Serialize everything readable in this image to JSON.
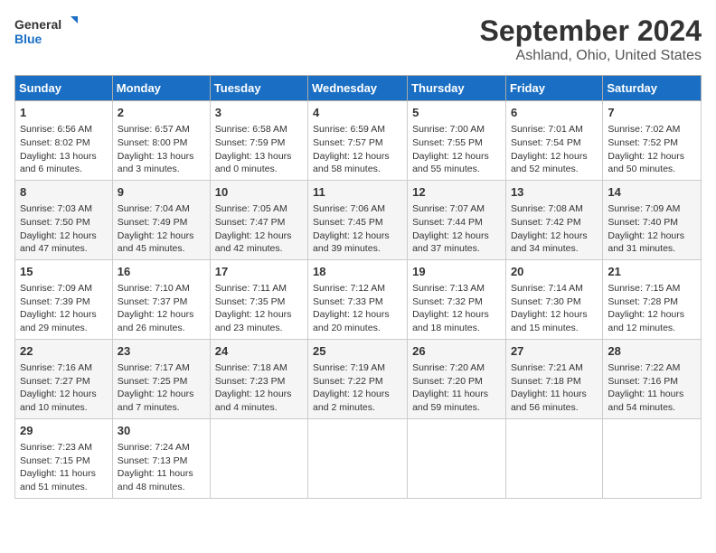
{
  "header": {
    "logo_line1": "General",
    "logo_line2": "Blue",
    "month_title": "September 2024",
    "location": "Ashland, Ohio, United States"
  },
  "days_of_week": [
    "Sunday",
    "Monday",
    "Tuesday",
    "Wednesday",
    "Thursday",
    "Friday",
    "Saturday"
  ],
  "weeks": [
    [
      {
        "day": "1",
        "info": "Sunrise: 6:56 AM\nSunset: 8:02 PM\nDaylight: 13 hours and 6 minutes."
      },
      {
        "day": "2",
        "info": "Sunrise: 6:57 AM\nSunset: 8:00 PM\nDaylight: 13 hours and 3 minutes."
      },
      {
        "day": "3",
        "info": "Sunrise: 6:58 AM\nSunset: 7:59 PM\nDaylight: 13 hours and 0 minutes."
      },
      {
        "day": "4",
        "info": "Sunrise: 6:59 AM\nSunset: 7:57 PM\nDaylight: 12 hours and 58 minutes."
      },
      {
        "day": "5",
        "info": "Sunrise: 7:00 AM\nSunset: 7:55 PM\nDaylight: 12 hours and 55 minutes."
      },
      {
        "day": "6",
        "info": "Sunrise: 7:01 AM\nSunset: 7:54 PM\nDaylight: 12 hours and 52 minutes."
      },
      {
        "day": "7",
        "info": "Sunrise: 7:02 AM\nSunset: 7:52 PM\nDaylight: 12 hours and 50 minutes."
      }
    ],
    [
      {
        "day": "8",
        "info": "Sunrise: 7:03 AM\nSunset: 7:50 PM\nDaylight: 12 hours and 47 minutes."
      },
      {
        "day": "9",
        "info": "Sunrise: 7:04 AM\nSunset: 7:49 PM\nDaylight: 12 hours and 45 minutes."
      },
      {
        "day": "10",
        "info": "Sunrise: 7:05 AM\nSunset: 7:47 PM\nDaylight: 12 hours and 42 minutes."
      },
      {
        "day": "11",
        "info": "Sunrise: 7:06 AM\nSunset: 7:45 PM\nDaylight: 12 hours and 39 minutes."
      },
      {
        "day": "12",
        "info": "Sunrise: 7:07 AM\nSunset: 7:44 PM\nDaylight: 12 hours and 37 minutes."
      },
      {
        "day": "13",
        "info": "Sunrise: 7:08 AM\nSunset: 7:42 PM\nDaylight: 12 hours and 34 minutes."
      },
      {
        "day": "14",
        "info": "Sunrise: 7:09 AM\nSunset: 7:40 PM\nDaylight: 12 hours and 31 minutes."
      }
    ],
    [
      {
        "day": "15",
        "info": "Sunrise: 7:09 AM\nSunset: 7:39 PM\nDaylight: 12 hours and 29 minutes."
      },
      {
        "day": "16",
        "info": "Sunrise: 7:10 AM\nSunset: 7:37 PM\nDaylight: 12 hours and 26 minutes."
      },
      {
        "day": "17",
        "info": "Sunrise: 7:11 AM\nSunset: 7:35 PM\nDaylight: 12 hours and 23 minutes."
      },
      {
        "day": "18",
        "info": "Sunrise: 7:12 AM\nSunset: 7:33 PM\nDaylight: 12 hours and 20 minutes."
      },
      {
        "day": "19",
        "info": "Sunrise: 7:13 AM\nSunset: 7:32 PM\nDaylight: 12 hours and 18 minutes."
      },
      {
        "day": "20",
        "info": "Sunrise: 7:14 AM\nSunset: 7:30 PM\nDaylight: 12 hours and 15 minutes."
      },
      {
        "day": "21",
        "info": "Sunrise: 7:15 AM\nSunset: 7:28 PM\nDaylight: 12 hours and 12 minutes."
      }
    ],
    [
      {
        "day": "22",
        "info": "Sunrise: 7:16 AM\nSunset: 7:27 PM\nDaylight: 12 hours and 10 minutes."
      },
      {
        "day": "23",
        "info": "Sunrise: 7:17 AM\nSunset: 7:25 PM\nDaylight: 12 hours and 7 minutes."
      },
      {
        "day": "24",
        "info": "Sunrise: 7:18 AM\nSunset: 7:23 PM\nDaylight: 12 hours and 4 minutes."
      },
      {
        "day": "25",
        "info": "Sunrise: 7:19 AM\nSunset: 7:22 PM\nDaylight: 12 hours and 2 minutes."
      },
      {
        "day": "26",
        "info": "Sunrise: 7:20 AM\nSunset: 7:20 PM\nDaylight: 11 hours and 59 minutes."
      },
      {
        "day": "27",
        "info": "Sunrise: 7:21 AM\nSunset: 7:18 PM\nDaylight: 11 hours and 56 minutes."
      },
      {
        "day": "28",
        "info": "Sunrise: 7:22 AM\nSunset: 7:16 PM\nDaylight: 11 hours and 54 minutes."
      }
    ],
    [
      {
        "day": "29",
        "info": "Sunrise: 7:23 AM\nSunset: 7:15 PM\nDaylight: 11 hours and 51 minutes."
      },
      {
        "day": "30",
        "info": "Sunrise: 7:24 AM\nSunset: 7:13 PM\nDaylight: 11 hours and 48 minutes."
      },
      {
        "day": "",
        "info": ""
      },
      {
        "day": "",
        "info": ""
      },
      {
        "day": "",
        "info": ""
      },
      {
        "day": "",
        "info": ""
      },
      {
        "day": "",
        "info": ""
      }
    ]
  ]
}
